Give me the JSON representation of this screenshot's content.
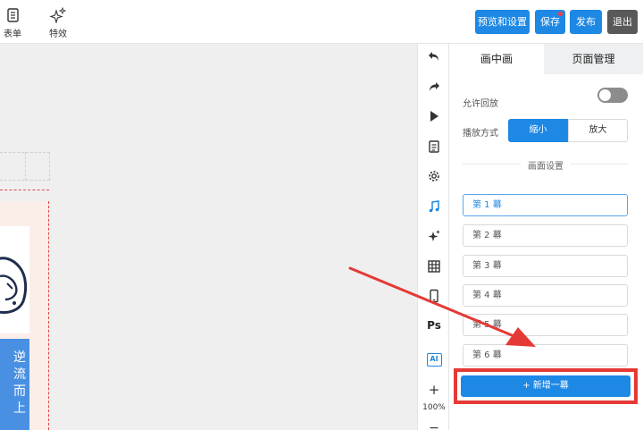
{
  "topbar": {
    "form_label": "表单",
    "effects_label": "特效",
    "preview_label": "预览和设置",
    "save_label": "保存",
    "publish_label": "发布",
    "exit_label": "退出"
  },
  "canvas": {
    "blue_card_text": [
      "逆",
      "流",
      "而",
      "上"
    ]
  },
  "vtoolbar": {
    "ps_label": "Ps",
    "ai_label": "AI",
    "zoom_in": "+",
    "zoom_level": "100%",
    "zoom_out": "−"
  },
  "panel": {
    "tabs": [
      {
        "label": "画中画",
        "active": true
      },
      {
        "label": "页面管理",
        "active": false
      }
    ],
    "allow_replay_label": "允许回放",
    "allow_replay_on": false,
    "play_mode_label": "播放方式",
    "play_mode_options": [
      "缩小",
      "放大"
    ],
    "play_mode_selected": "缩小",
    "section_title": "画面设置",
    "scenes": [
      "第 1 幕",
      "第 2 幕",
      "第 3 幕",
      "第 4 幕",
      "第 5 幕",
      "第 6 幕"
    ],
    "add_scene_label": "+ 新增一幕"
  },
  "colors": {
    "accent": "#1e88e5",
    "highlight": "#e53935"
  }
}
